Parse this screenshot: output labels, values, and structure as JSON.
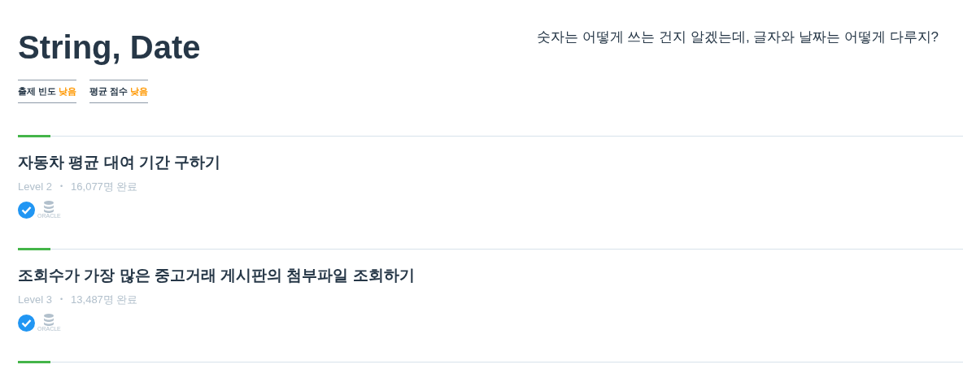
{
  "header": {
    "title": "String, Date",
    "subtitle": "숫자는 어떻게 쓰는 건지 알겠는데, 글자와 날짜는 어떻게 다루지?"
  },
  "badges": [
    {
      "label": "출제 빈도",
      "value": "낮음"
    },
    {
      "label": "평균 점수",
      "value": "낮음"
    }
  ],
  "problems": [
    {
      "title": "자동차 평균 대여 기간 구하기",
      "level": "Level 2",
      "separator": "•",
      "completed": "16,077명 완료",
      "solved": true,
      "db_label": "ORACLE"
    },
    {
      "title": "조회수가 가장 많은 중고거래 게시판의 첨부파일 조회하기",
      "level": "Level 3",
      "separator": "•",
      "completed": "13,487명 완료",
      "solved": true,
      "db_label": "ORACLE"
    }
  ]
}
